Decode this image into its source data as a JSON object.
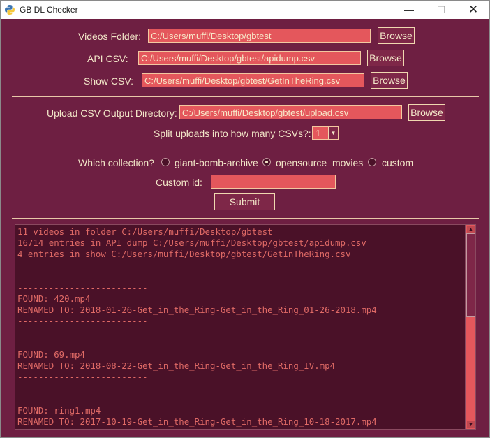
{
  "window": {
    "title": "GB DL Checker",
    "min_glyph": "—",
    "max_glyph": "☐",
    "close_glyph": "✕"
  },
  "videos_folder": {
    "label": "Videos Folder:",
    "value": "C:/Users/muffi/Desktop/gbtest",
    "browse": "Browse"
  },
  "api_csv": {
    "label": "API CSV:",
    "value": "C:/Users/muffi/Desktop/gbtest/apidump.csv",
    "browse": "Browse"
  },
  "show_csv": {
    "label": "Show CSV:",
    "value": "C:/Users/muffi/Desktop/gbtest/GetInTheRing.csv",
    "browse": "Browse"
  },
  "upload_csv": {
    "label": "Upload CSV Output Directory:",
    "value": "C:/Users/muffi/Desktop/gbtest/upload.csv",
    "browse": "Browse"
  },
  "split": {
    "label": "Split uploads into how many CSVs?:",
    "value": "1"
  },
  "collection": {
    "label": "Which collection?",
    "options": [
      "giant-bomb-archive",
      "opensource_movies",
      "custom"
    ],
    "selected": "opensource_movies"
  },
  "custom_id": {
    "label": "Custom id:",
    "value": ""
  },
  "submit_label": "Submit",
  "console_lines": [
    "11 videos in folder C:/Users/muffi/Desktop/gbtest",
    "16714 entries in API dump C:/Users/muffi/Desktop/gbtest/apidump.csv",
    "4 entries in show C:/Users/muffi/Desktop/gbtest/GetInTheRing.csv",
    "",
    "",
    "-------------------------",
    "FOUND: 420.mp4",
    "RENAMED TO: 2018-01-26-Get_in_the_Ring-Get_in_the_Ring_01-26-2018.mp4",
    "-------------------------",
    "",
    "-------------------------",
    "FOUND: 69.mp4",
    "RENAMED TO: 2018-08-22-Get_in_the_Ring-Get_in_the_Ring_IV.mp4",
    "-------------------------",
    "",
    "-------------------------",
    "FOUND: ring1.mp4",
    "RENAMED TO: 2017-10-19-Get_in_the_Ring-Get_in_the_Ring_10-18-2017.mp4"
  ],
  "colors": {
    "background": "#6e1f42",
    "field": "#e4575c",
    "button": "#7e2748",
    "text": "#f2e6c8",
    "console_bg": "#4a1128",
    "console_text": "#e06a66"
  }
}
